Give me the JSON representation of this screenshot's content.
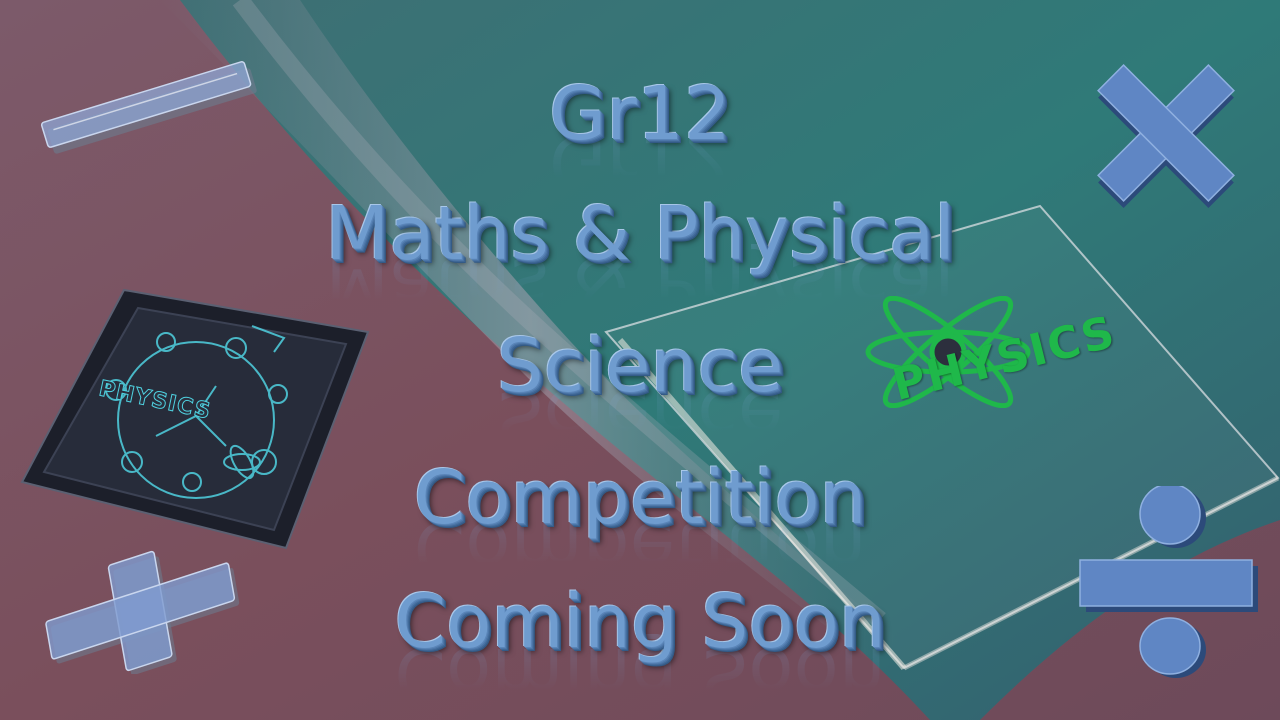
{
  "slide": {
    "title_lines": [
      "Gr12",
      "Maths & Physical",
      "Science",
      "Competition",
      "Coming Soon"
    ]
  },
  "decor": {
    "physics_logo_label": "PHYSICS",
    "physics_tile_label": "PHYSICS",
    "icons": [
      "minus-icon",
      "multiply-icon",
      "plus-icon",
      "divide-icon",
      "atom-icon",
      "physics-tile-icon"
    ]
  },
  "colors": {
    "title_text": "#6f9ccf",
    "sand": "#7a4f5c",
    "sea": "#2f7a78",
    "symbol_blue": "#5f86c4",
    "physics_green": "#1fb84a"
  }
}
